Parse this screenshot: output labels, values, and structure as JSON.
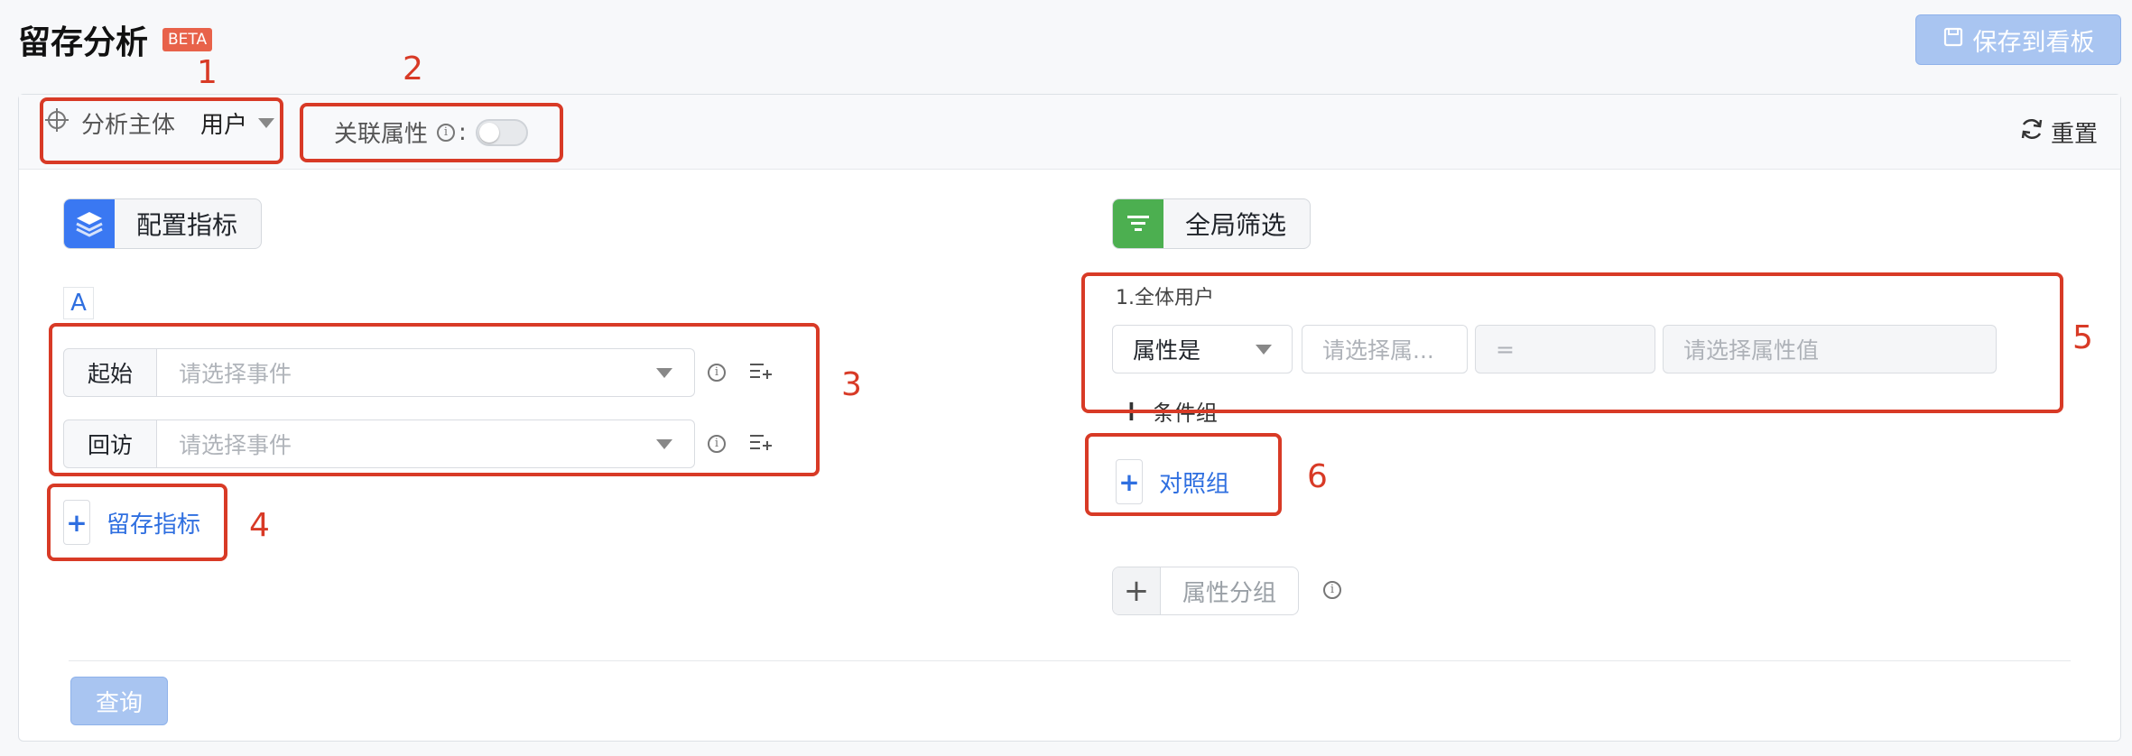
{
  "header": {
    "title": "留存分析",
    "badge": "BETA",
    "save_label": "保存到看板"
  },
  "toolbar": {
    "subject_label": "分析主体",
    "subject_value": "用户",
    "assoc_label": "关联属性",
    "assoc_info": "i",
    "assoc_colon": ":",
    "assoc_toggle_on": false,
    "reset_label": "重置"
  },
  "left": {
    "section_label": "配置指标",
    "group_tag": "A",
    "rows": [
      {
        "tag": "起始",
        "placeholder": "请选择事件"
      },
      {
        "tag": "回访",
        "placeholder": "请选择事件"
      }
    ],
    "info_glyph": "i",
    "add_metric_label": "留存指标"
  },
  "right": {
    "section_label": "全局筛选",
    "filter_title": "1.全体用户",
    "filter_select": "属性是",
    "filter_prop_placeholder": "请选择属...",
    "filter_op": "=",
    "filter_value_placeholder": "请选择属性值",
    "add_condition_label": "条件组",
    "compare_label": "对照组",
    "group_label": "属性分组",
    "info_glyph": "i"
  },
  "annotations": [
    "1",
    "2",
    "3",
    "4",
    "5",
    "6"
  ],
  "footer": {
    "query_label": "查询"
  },
  "colors": {
    "accent": "#2f6fe0",
    "annotation_red": "#d83a26",
    "config_icon": "#3a78f2",
    "filter_icon": "#4caf50"
  }
}
